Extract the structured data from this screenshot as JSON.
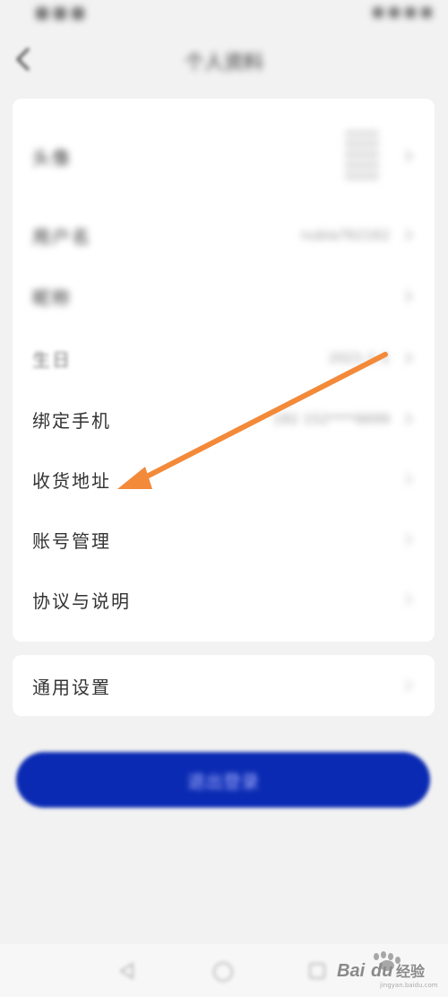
{
  "status_bar": {
    "left_text": "",
    "right_text": ""
  },
  "header": {
    "title": "个人资料"
  },
  "profile": {
    "rows": [
      {
        "label": "头像",
        "value": ""
      },
      {
        "label": "用户名",
        "value": "nubia762162"
      },
      {
        "label": "昵称",
        "value": ""
      },
      {
        "label": "生日",
        "value": "2021-1-1"
      },
      {
        "label": "绑定手机",
        "value": "182 152****6699"
      },
      {
        "label": "收货地址",
        "value": ""
      },
      {
        "label": "账号管理",
        "value": ""
      },
      {
        "label": "协议与说明",
        "value": ""
      }
    ]
  },
  "settings": {
    "label": "通用设置"
  },
  "logout": {
    "label": "退出登录"
  },
  "colors": {
    "accent": "#0a2ab3",
    "arrow": "#f28a3a",
    "background": "#f2f2f2"
  },
  "icons": {
    "back": "back-icon",
    "chevron": "chevron-right-icon",
    "nav_back": "triangle-back-icon",
    "nav_home": "circle-home-icon",
    "nav_recent": "square-recent-icon"
  },
  "watermark": {
    "text": "Baidu经验",
    "sub": "jingyan.baidu.com"
  }
}
